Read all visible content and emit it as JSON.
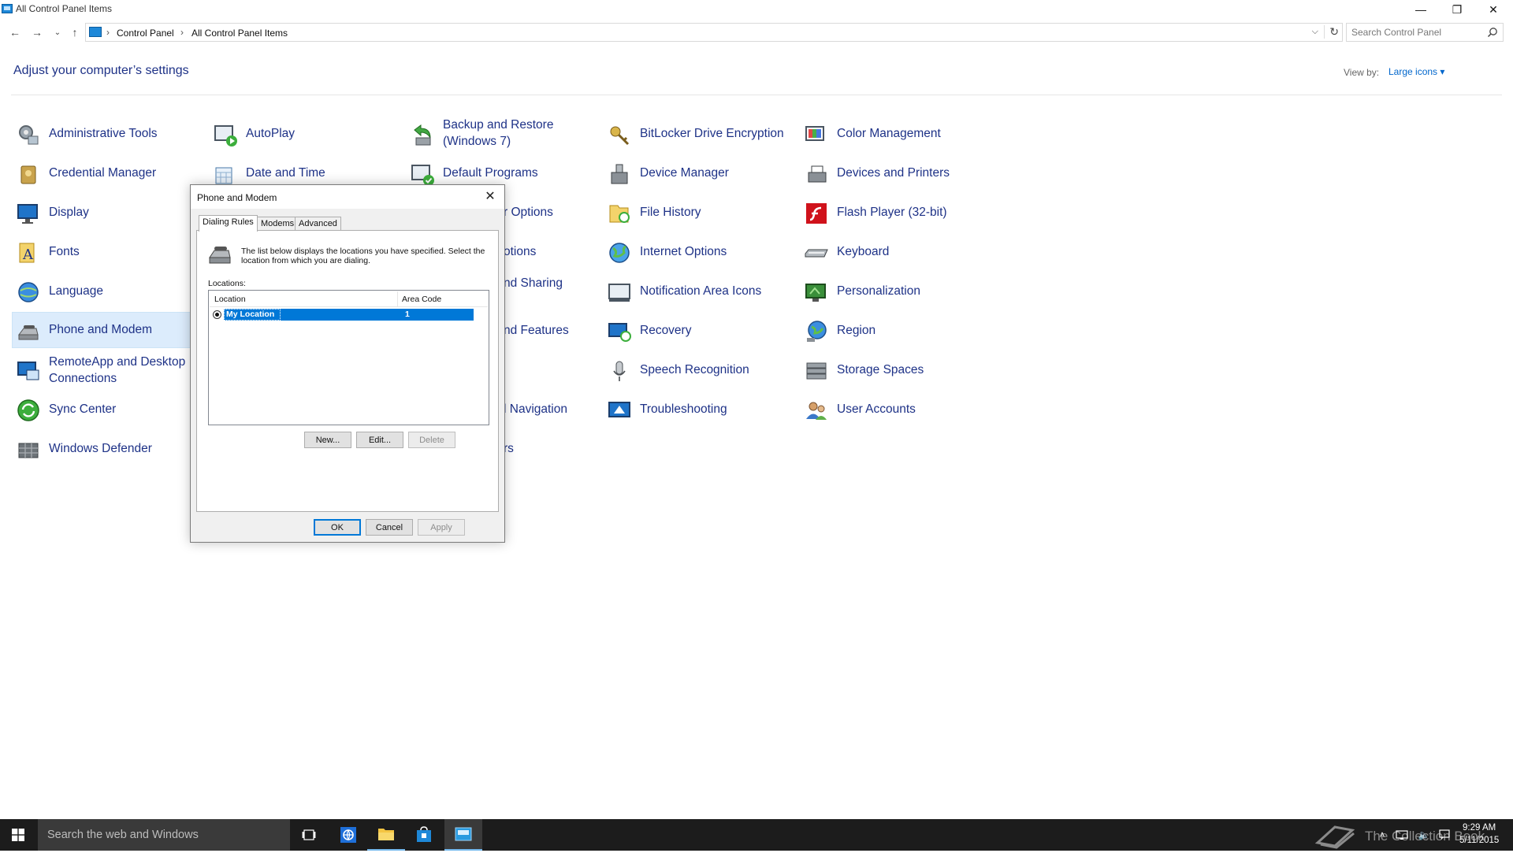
{
  "window": {
    "title": "All Control Panel Items",
    "minimize_label": "—",
    "restore_label": "❐",
    "close_label": "✕"
  },
  "address_bar": {
    "breadcrumbs": [
      "Control Panel",
      "All Control Panel Items"
    ],
    "search_placeholder": "Search Control Panel"
  },
  "header": {
    "heading": "Adjust your computer’s settings",
    "view_by_label": "View by:",
    "view_by_value": "Large icons ▾"
  },
  "items": {
    "administrative_tools": "Administrative Tools",
    "autoplay": "AutoPlay",
    "backup_restore_line1": "Backup and Restore",
    "backup_restore_line2": "(Windows 7)",
    "bitlocker": "BitLocker Drive Encryption",
    "color_management": "Color Management",
    "credential_manager": "Credential Manager",
    "date_time": "Date and Time",
    "default_programs": "Default Programs",
    "device_manager": "Device Manager",
    "devices_printers": "Devices and Printers",
    "display": "Display",
    "ease_of_access_partial": "r Options",
    "file_history": "File History",
    "flash_player": "Flash Player (32-bit)",
    "fonts": "Fonts",
    "indexing_partial": "otions",
    "internet_options": "Internet Options",
    "keyboard": "Keyboard",
    "language": "Language",
    "network_sharing_partial": "nd Sharing",
    "notification_area_icons": "Notification Area Icons",
    "personalization": "Personalization",
    "phone_modem": "Phone and Modem",
    "programs_features_partial": "nd Features",
    "recovery": "Recovery",
    "region": "Region",
    "remoteapp_line1": "RemoteApp and Desktop",
    "remoteapp_line2": "Connections",
    "speech_recognition": "Speech Recognition",
    "storage_spaces": "Storage Spaces",
    "sync_center": "Sync Center",
    "taskbar_navigation_partial": "l Navigation",
    "troubleshooting": "Troubleshooting",
    "user_accounts": "User Accounts",
    "windows_defender": "Windows Defender",
    "user_accounts_partial": "rs"
  },
  "dialog": {
    "title": "Phone and Modem",
    "close_label": "✕",
    "tabs": [
      "Dialing Rules",
      "Modems",
      "Advanced"
    ],
    "description": "The list below displays the locations you have specified. Select the location from which you are dialing.",
    "locations_label": "Locations:",
    "columns": [
      "Location",
      "Area Code"
    ],
    "rows": [
      {
        "location": "My Location",
        "area_code": "1"
      }
    ],
    "buttons": {
      "new": "New...",
      "edit": "Edit...",
      "delete": "Delete",
      "ok": "OK",
      "cancel": "Cancel",
      "apply": "Apply"
    }
  },
  "taskbar": {
    "search_text": "Search the web and Windows",
    "clock_time": "9:29 AM",
    "clock_date": "5/11/2015"
  },
  "watermark": {
    "text": "The Collection Book"
  },
  "colors": {
    "link_blue": "#1e3287",
    "selection_blue": "#0078d7",
    "selected_item_bg": "#dcecfc",
    "taskbar": "#1c1c1c"
  }
}
